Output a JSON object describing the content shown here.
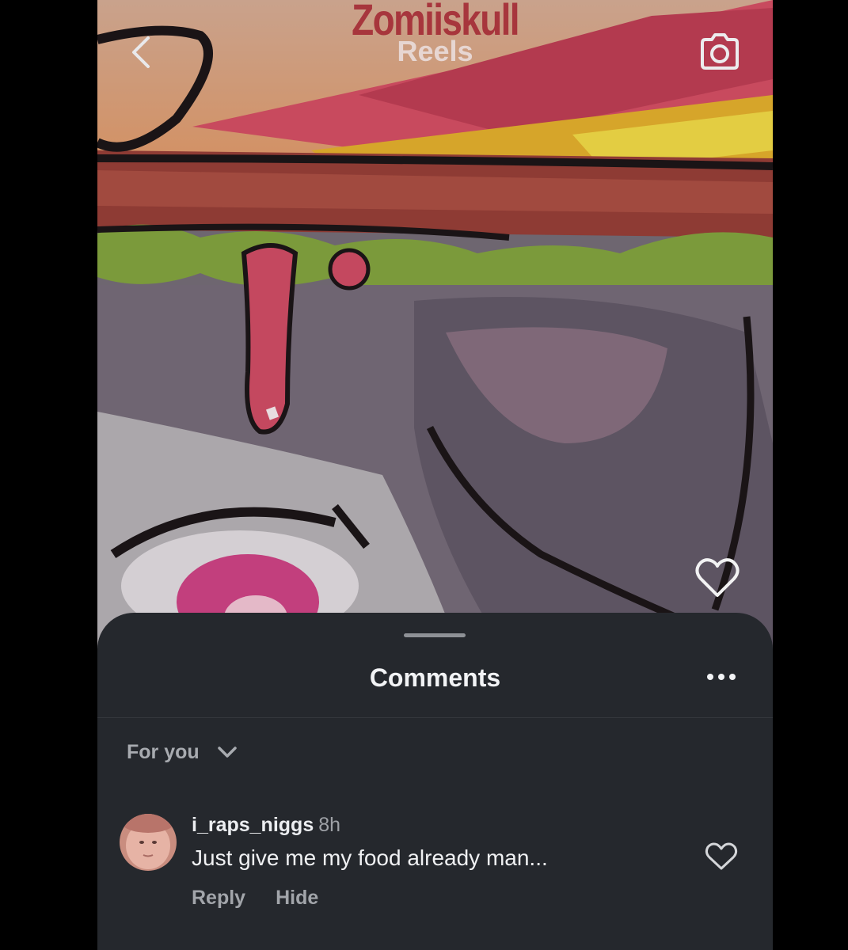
{
  "reel": {
    "watermark": "Zomiiskull",
    "title": "Reels",
    "back_icon": "chevron-left-icon",
    "camera_icon": "camera-icon",
    "like_icon": "heart-outline-icon"
  },
  "comments_sheet": {
    "title": "Comments",
    "more_icon": "more-horizontal-icon",
    "sort": {
      "label": "For you",
      "icon": "chevron-down-icon"
    },
    "comments": [
      {
        "username": "i_raps_niggs",
        "time": "8h",
        "text": "Just give me my food already man...",
        "reply_label": "Reply",
        "hide_label": "Hide",
        "like_icon": "heart-outline-icon"
      }
    ]
  },
  "colors": {
    "sheet_background": "#25282d",
    "page_background": "#000000",
    "watermark": "#a42b35"
  }
}
